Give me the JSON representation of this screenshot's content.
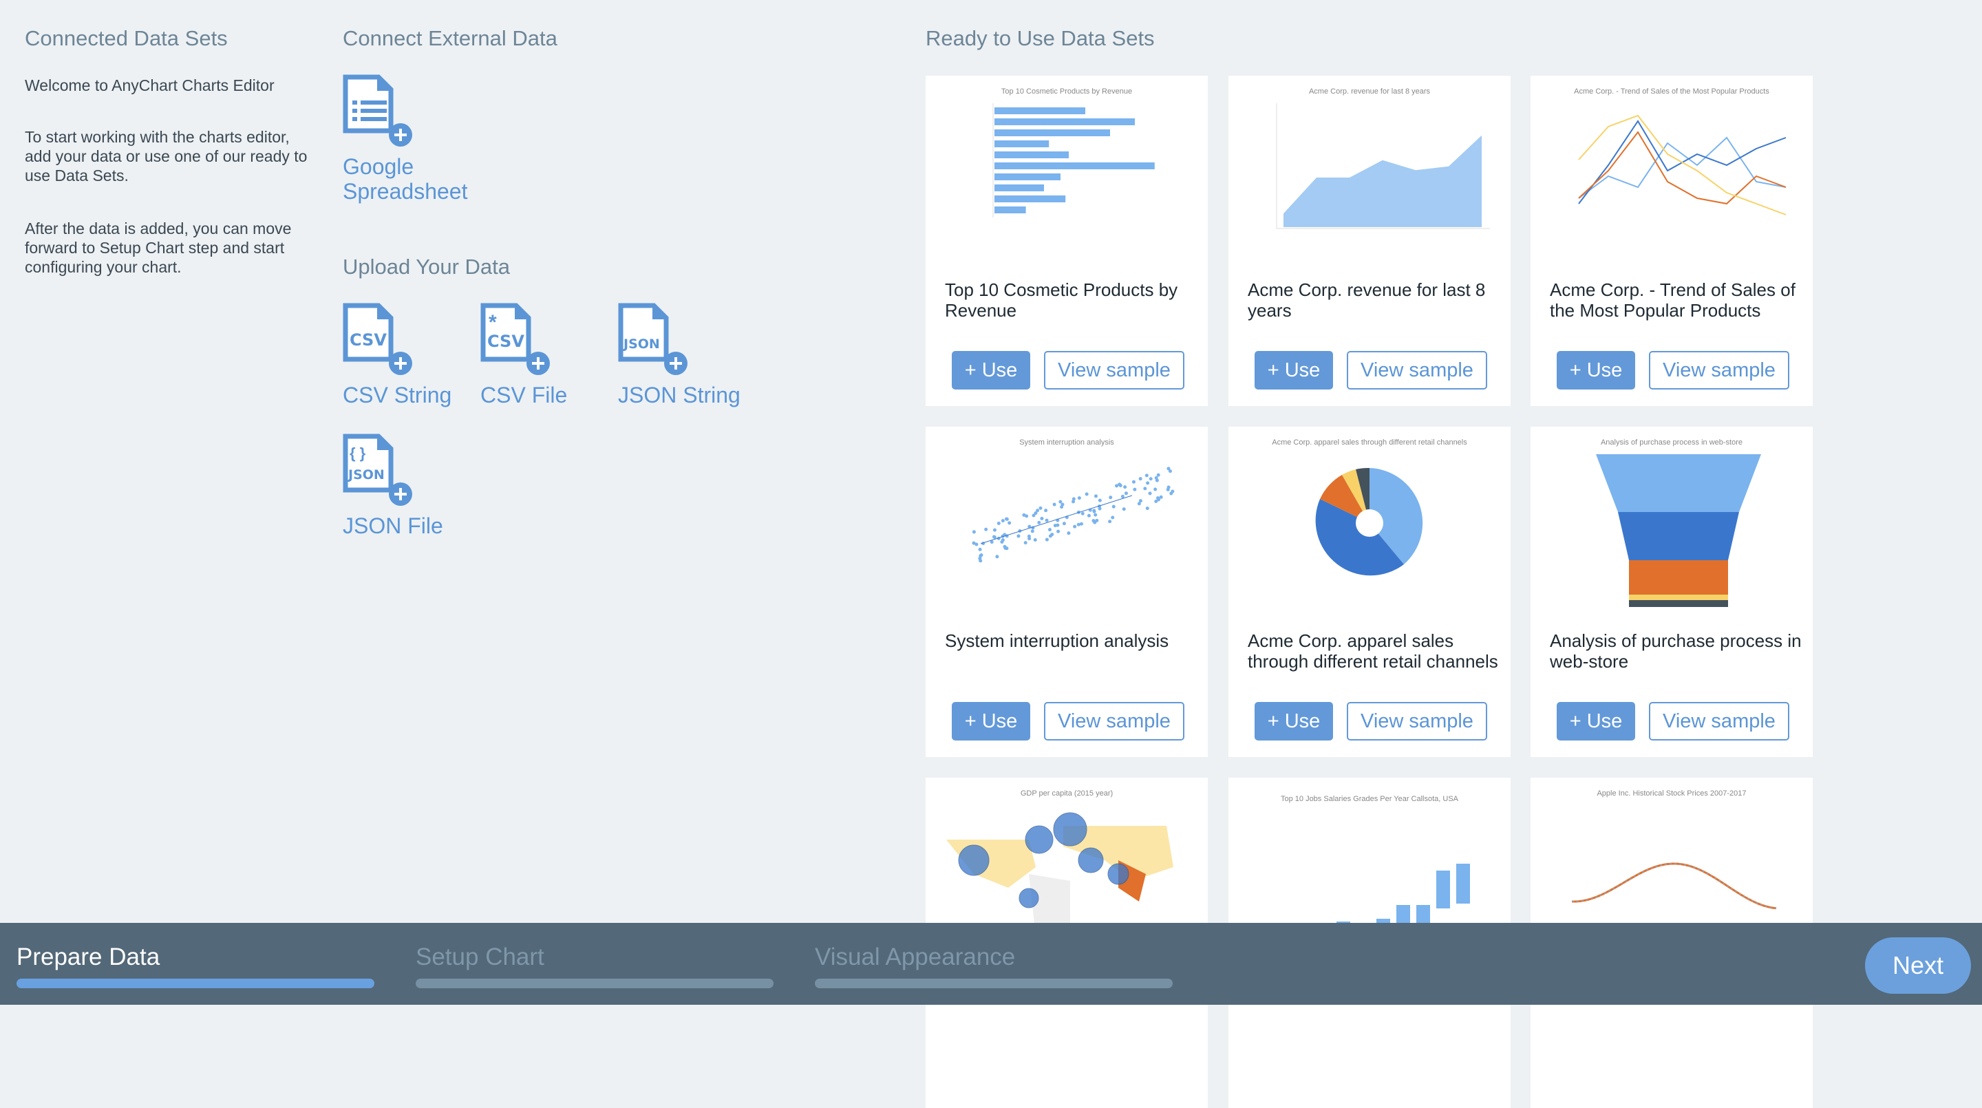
{
  "left": {
    "title": "Connected Data Sets",
    "welcome": "Welcome to AnyChart Charts Editor",
    "p1": "To start working with the charts editor, add your data or use one of our ready to use Data Sets.",
    "p2": "After the data is added, you can move forward to Setup Chart step and start configuring your chart."
  },
  "external": {
    "title": "Connect External Data",
    "google": "Google Spreadsheet"
  },
  "upload": {
    "title": "Upload Your Data",
    "items": [
      {
        "label": "CSV String",
        "icon": "csv-string-icon"
      },
      {
        "label": "CSV File",
        "icon": "csv-file-icon"
      },
      {
        "label": "JSON String",
        "icon": "json-string-icon"
      },
      {
        "label": "JSON File",
        "icon": "json-file-icon"
      }
    ]
  },
  "ready": {
    "title": "Ready to Use Data Sets",
    "use_label": "+ Use",
    "view_label": "View sample",
    "cards": [
      {
        "title": "Top 10 Cosmetic Products by Revenue",
        "thumb_title": "Top 10 Cosmetic Products by Revenue",
        "kind": "hbar"
      },
      {
        "title": "Acme Corp. revenue for last 8 years",
        "thumb_title": "Acme Corp. revenue for last 8 years",
        "kind": "area"
      },
      {
        "title": "Acme Corp. - Trend of Sales of the Most Popular Products",
        "thumb_title": "Acme Corp. - Trend of Sales of the Most Popular Products",
        "kind": "line"
      },
      {
        "title": "System interruption analysis",
        "thumb_title": "System interruption analysis",
        "kind": "scatter"
      },
      {
        "title": "Acme Corp. apparel sales through different retail channels",
        "thumb_title": "Acme Corp. apparel sales through different retail channels",
        "kind": "pie"
      },
      {
        "title": "Analysis of purchase process in web-store",
        "thumb_title": "Analysis of purchase process in web-store",
        "kind": "funnel"
      },
      {
        "title": "",
        "thumb_title": "GDP per capita (2015 year)",
        "kind": "map"
      },
      {
        "title": "",
        "thumb_title": "Top 10 Jobs Salaries Grades Per Year Callsota, USA",
        "kind": "box"
      },
      {
        "title": "",
        "thumb_title": "Apple Inc. Historical Stock Prices 2007-2017",
        "kind": "stock"
      }
    ]
  },
  "footer": {
    "steps": [
      {
        "label": "Prepare Data",
        "active": true
      },
      {
        "label": "Setup Chart",
        "active": false
      },
      {
        "label": "Visual Appearance",
        "active": false
      }
    ],
    "next": "Next"
  },
  "colors": {
    "accent": "#6399d8",
    "footer": "#536878",
    "blue_light": "#7ab3ee",
    "blue_dark": "#3a77cc",
    "orange": "#e0702b",
    "yellow": "#f8d268"
  }
}
